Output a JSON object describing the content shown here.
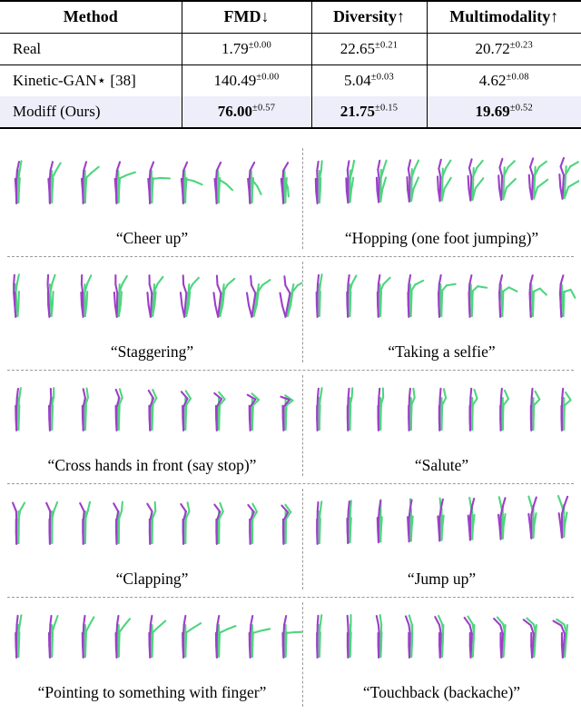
{
  "table": {
    "headers": [
      "Method",
      "FMD↓",
      "Diversity↑",
      "Multimodality↑"
    ],
    "rows": [
      {
        "method": "Real",
        "highlight": false,
        "bold": false,
        "cells": [
          {
            "value": "1.79",
            "err": "±0.00"
          },
          {
            "value": "22.65",
            "err": "±0.21"
          },
          {
            "value": "20.72",
            "err": "±0.23"
          }
        ]
      },
      {
        "method": "Kinetic-GAN⋆ [38]",
        "highlight": false,
        "bold": false,
        "cells": [
          {
            "value": "140.49",
            "err": "±0.00"
          },
          {
            "value": "5.04",
            "err": "±0.03"
          },
          {
            "value": "4.62",
            "err": "±0.08"
          }
        ]
      },
      {
        "method": "Modiff (Ours)",
        "highlight": true,
        "bold": true,
        "cells": [
          {
            "value": "76.00",
            "err": "±0.57"
          },
          {
            "value": "21.75",
            "err": "±0.15"
          },
          {
            "value": "19.69",
            "err": "±0.52"
          }
        ]
      }
    ]
  },
  "colors": {
    "limb_green": "#4ed57e",
    "limb_purple": "#9d3fc8",
    "highlight_row": "#eeeefa",
    "separator": "#9a9a9a",
    "rule": "#000000"
  },
  "figure": {
    "frames_per_sequence": 9,
    "rows": [
      {
        "left": {
          "caption": "“Cheer up”",
          "action": "cheer_up"
        },
        "right": {
          "caption": "“Hopping (one foot jumping)”",
          "action": "hopping"
        }
      },
      {
        "left": {
          "caption": "“Staggering”",
          "action": "staggering"
        },
        "right": {
          "caption": "“Taking a selfie”",
          "action": "selfie"
        }
      },
      {
        "left": {
          "caption": "“Cross hands in front (say stop)”",
          "action": "cross_hands"
        },
        "right": {
          "caption": "“Salute”",
          "action": "salute"
        }
      },
      {
        "left": {
          "caption": "“Clapping”",
          "action": "clapping"
        },
        "right": {
          "caption": "“Jump up”",
          "action": "jump_up"
        }
      },
      {
        "left": {
          "caption": "“Pointing to something with finger”",
          "action": "pointing"
        },
        "right": {
          "caption": "“Touchback (backache)”",
          "action": "touchback"
        }
      }
    ]
  }
}
